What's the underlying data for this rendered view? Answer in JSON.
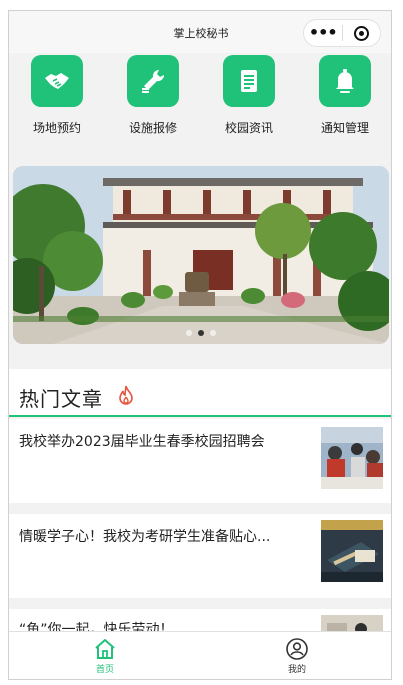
{
  "header": {
    "title": "掌上校秘书"
  },
  "grid": [
    {
      "label": "场地预约",
      "icon": "handshake-icon"
    },
    {
      "label": "设施报修",
      "icon": "wrench-icon"
    },
    {
      "label": "校园资讯",
      "icon": "document-icon"
    },
    {
      "label": "通知管理",
      "icon": "bell-icon"
    }
  ],
  "banner": {
    "slide_count": 3,
    "active_slide": 2
  },
  "hot_section": {
    "title": "热门文章"
  },
  "articles": [
    {
      "title": "我校举办2023届毕业生春季校园招聘会"
    },
    {
      "title": "情暖学子心！我校为考研学生准备贴心..."
    },
    {
      "title": "“鱼”你一起，快乐劳动！"
    }
  ],
  "tabbar": {
    "home": "首页",
    "mine": "我的"
  },
  "colors": {
    "accent": "#20c27a"
  }
}
